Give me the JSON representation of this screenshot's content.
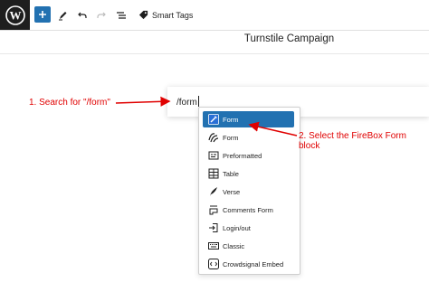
{
  "toolbar": {
    "smart_tags_label": "Smart Tags"
  },
  "document": {
    "title": "Turnstile Campaign"
  },
  "editor": {
    "search_value": "/form"
  },
  "inserter": {
    "items": [
      {
        "label": "Form",
        "icon": "firebox-form-icon",
        "selected": true
      },
      {
        "label": "Form",
        "icon": "form-icon",
        "selected": false
      },
      {
        "label": "Preformatted",
        "icon": "preformatted-icon",
        "selected": false
      },
      {
        "label": "Table",
        "icon": "table-icon",
        "selected": false
      },
      {
        "label": "Verse",
        "icon": "verse-icon",
        "selected": false
      },
      {
        "label": "Comments Form",
        "icon": "comments-form-icon",
        "selected": false
      },
      {
        "label": "Login/out",
        "icon": "login-icon",
        "selected": false
      },
      {
        "label": "Classic",
        "icon": "classic-icon",
        "selected": false
      },
      {
        "label": "Crowdsignal Embed",
        "icon": "crowdsignal-icon",
        "selected": false
      }
    ]
  },
  "annotations": {
    "step1": "1. Search for \"/form\"",
    "step2": "2. Select the FireBox Form block"
  },
  "colors": {
    "accent": "#2271b1",
    "annotation": "#e00000",
    "logo_bg": "#1e1e1e"
  }
}
